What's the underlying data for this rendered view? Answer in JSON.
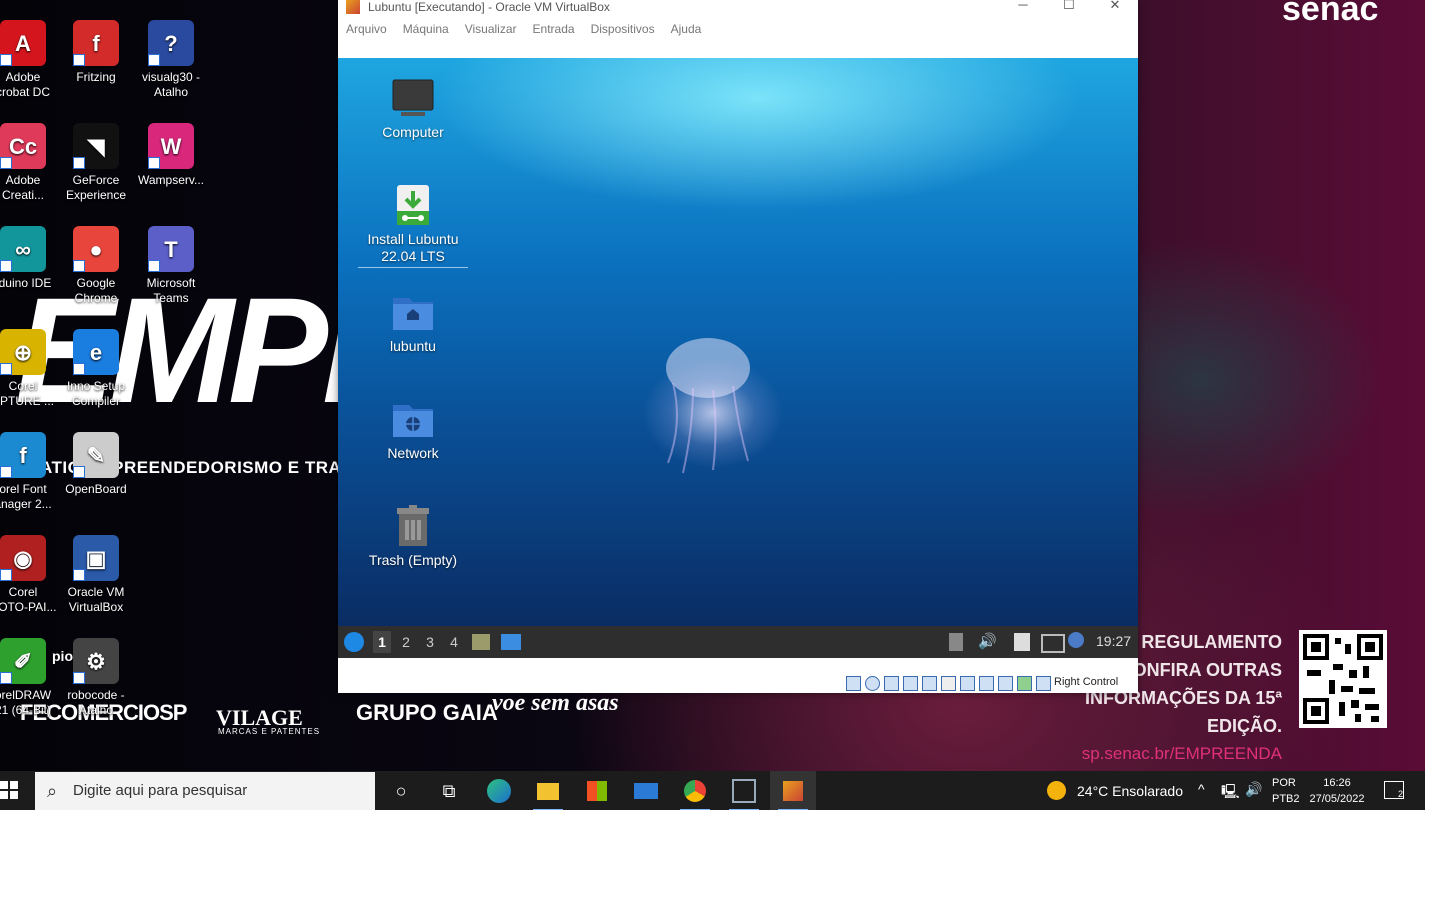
{
  "host_desktop": {
    "icons": [
      {
        "label": "Adobe\ncrobat DC",
        "name": "adobe-acrobat-icon",
        "color": "#d4151d",
        "glyph": "A"
      },
      {
        "label": "Fritzing",
        "name": "fritzing-icon",
        "color": "#d32a2a",
        "glyph": "f"
      },
      {
        "label": "visualg30 -\nAtalho",
        "name": "visualg-icon",
        "color": "#2a4aa0",
        "glyph": "?"
      },
      {
        "label": "Adobe\nCreati...",
        "name": "adobe-creative-cloud-icon",
        "color": "#e03a5a",
        "glyph": "Cc"
      },
      {
        "label": "GeForce\nExperience",
        "name": "geforce-experience-icon",
        "color": "#111",
        "glyph": "◥"
      },
      {
        "label": "Wampserv...",
        "name": "wampserver-icon",
        "color": "#d9277c",
        "glyph": "W"
      },
      {
        "label": "rduino IDE",
        "name": "arduino-ide-icon",
        "color": "#12969c",
        "glyph": "∞"
      },
      {
        "label": "Google\nChrome",
        "name": "google-chrome-icon",
        "color": "#e8453c",
        "glyph": "●"
      },
      {
        "label": "Microsoft\nTeams",
        "name": "microsoft-teams-icon",
        "color": "#5b5fc7",
        "glyph": "T"
      },
      {
        "label": "Corel\nAPTURE ...",
        "name": "corel-capture-icon",
        "color": "#d8b400",
        "glyph": "⊕"
      },
      {
        "label": "Inno Setup\nCompiler",
        "name": "inno-setup-icon",
        "color": "#1a7de0",
        "glyph": "e"
      },
      {
        "label": "orel Font\nanager 2...",
        "name": "corel-font-manager-icon",
        "color": "#1c8ad0",
        "glyph": "f"
      },
      {
        "label": "OpenBoard",
        "name": "openboard-icon",
        "color": "#cccccc",
        "glyph": "✎"
      },
      {
        "label": "Corel\nHOTO-PAI...",
        "name": "corel-photo-paint-icon",
        "color": "#b02020",
        "glyph": "◉"
      },
      {
        "label": "Oracle VM\nVirtualBox",
        "name": "virtualbox-icon",
        "color": "#2a5aa8",
        "glyph": "▣"
      },
      {
        "label": "orelDRAW\n21 (64-Bit)",
        "name": "coreldraw-icon",
        "color": "#2ea02e",
        "glyph": "✐"
      },
      {
        "label": "robocode -\nAtalho",
        "name": "robocode-icon",
        "color": "#444",
        "glyph": "⚙"
      }
    ],
    "wallpaper": {
      "big_text": "EMPR",
      "line_text": "ATIC EMPREENDEDORISMO E TRANS",
      "senac": "senac",
      "reg_lines": [
        "A O REGULAMENTO",
        "CONFIRA OUTRAS",
        "INFORMAÇÕES DA 15ª EDIÇÃO."
      ],
      "url": "sp.senac.br/EMPREENDA",
      "prefix": "pio:",
      "sponsors": [
        "FECOMERCIOSP",
        "VILAGE",
        "GRUPO GAIA",
        "voe sem asas"
      ],
      "vilage_sub": "MARCAS E PATENTES"
    }
  },
  "vm_window": {
    "title": "Lubuntu [Executando] - Oracle VM VirtualBox",
    "menu": [
      "Arquivo",
      "Máquina",
      "Visualizar",
      "Entrada",
      "Dispositivos",
      "Ajuda"
    ],
    "guest": {
      "icons": [
        {
          "label": "Computer",
          "name": "computer-icon"
        },
        {
          "label": "Install Lubuntu\n22.04 LTS",
          "name": "install-lubuntu-icon"
        },
        {
          "label": "lubuntu",
          "name": "home-folder-icon"
        },
        {
          "label": "Network",
          "name": "network-folder-icon"
        },
        {
          "label": "Trash (Empty)",
          "name": "trash-icon"
        }
      ],
      "workspaces": [
        "1",
        "2",
        "3",
        "4"
      ],
      "active_workspace": "1",
      "clock": "19:27"
    },
    "host_key": "Right Control"
  },
  "taskbar": {
    "search_placeholder": "Digite aqui para pesquisar",
    "weather": "24°C  Ensolarado",
    "lang": "POR",
    "layout": "PTB2",
    "time": "16:26",
    "date": "27/05/2022",
    "notifications": "2"
  }
}
